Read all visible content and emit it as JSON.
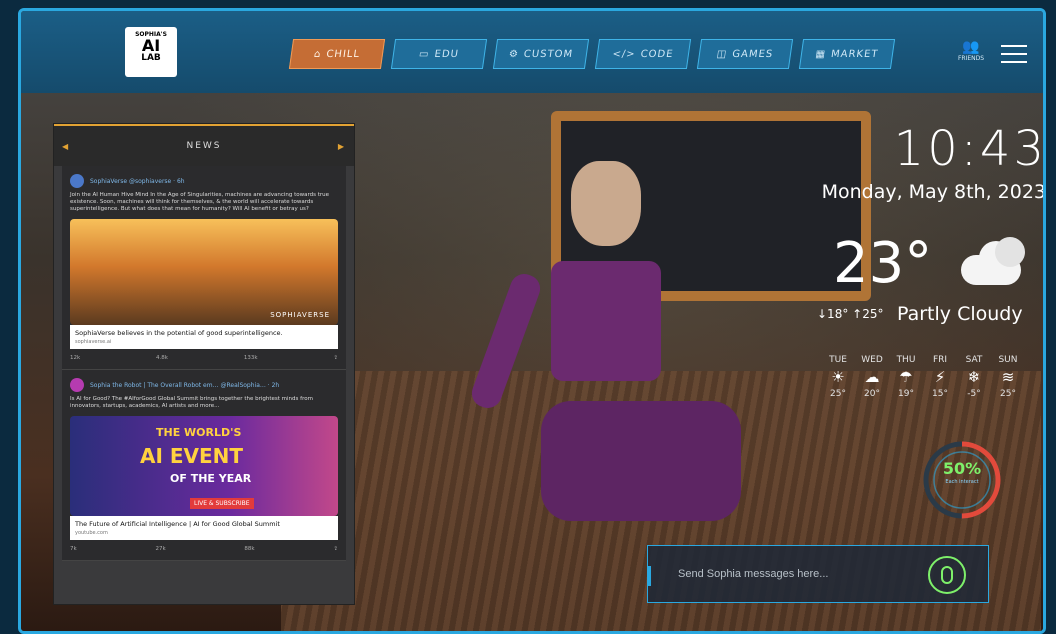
{
  "logo": {
    "small": "SOPHIA'S",
    "big": "AI",
    "lab": "LAB"
  },
  "nav": {
    "items": [
      {
        "label": "CHILL",
        "icon": "home-icon",
        "active": true
      },
      {
        "label": "EDU",
        "icon": "book-icon",
        "active": false
      },
      {
        "label": "CUSTOM",
        "icon": "gear-icon",
        "active": false
      },
      {
        "label": "CODE",
        "icon": "code-icon",
        "active": false
      },
      {
        "label": "GAMES",
        "icon": "gamepad-icon",
        "active": false
      },
      {
        "label": "MARKET",
        "icon": "store-icon",
        "active": false
      }
    ]
  },
  "friends": {
    "label": "FRIENDS"
  },
  "news": {
    "title": "NEWS",
    "posts": [
      {
        "author": "SophiaVerse @sophiaverse · 6h",
        "text": "Join the AI Human Hive Mind\nIn the Age of Singularities, machines are advancing towards true existence. Soon, machines will think for themselves, & the world will accelerate towards superintelligence. But what does that mean for humanity? Will AI benefit or betray us?",
        "watermark": "SOPHIAVERSE",
        "caption": "SophiaVerse believes in the potential of good superintelligence.",
        "source": "sophiaverse.ai",
        "actions": [
          "12k",
          "4.8k",
          "133k",
          ""
        ]
      },
      {
        "author": "Sophia the Robot | The Overall Robot em… @RealSophia… · 2h",
        "text": "Is AI for Good? The #AIforGood Global Summit brings together the brightest minds from innovators, startups, academics, AI artists and more...",
        "img_line1": "THE WORLD'S",
        "img_line2": "AI EVENT",
        "img_line3": "OF THE YEAR",
        "img_live": "LIVE & SUBSCRIBE",
        "caption": "The Future of Artificial Intelligence | AI for Good Global Summit",
        "source": "youtube.com",
        "actions": [
          "7k",
          "27k",
          "88k",
          ""
        ]
      }
    ]
  },
  "clock": {
    "time": "10:43",
    "date": "Monday, May 8th, 2023"
  },
  "weather": {
    "temp": "23°",
    "minmax": "↓18° ↑25°",
    "condition": "Partly Cloudy",
    "forecast": [
      {
        "day": "TUE",
        "icon": "sun-icon",
        "temp": "25°"
      },
      {
        "day": "WED",
        "icon": "cloud-icon",
        "temp": "20°"
      },
      {
        "day": "THU",
        "icon": "rain-icon",
        "temp": "19°"
      },
      {
        "day": "FRI",
        "icon": "storm-icon",
        "temp": "15°"
      },
      {
        "day": "SAT",
        "icon": "snow-icon",
        "temp": "-5°"
      },
      {
        "day": "SUN",
        "icon": "wind-icon",
        "temp": "25°"
      }
    ]
  },
  "progress": {
    "value": 0.5,
    "label_pct": "50%",
    "label": "Each interact"
  },
  "message": {
    "placeholder": "Send Sophia messages here..."
  },
  "colors": {
    "accent": "#2aa8e0",
    "active": "#c56d35",
    "mic": "#7ef06a"
  }
}
